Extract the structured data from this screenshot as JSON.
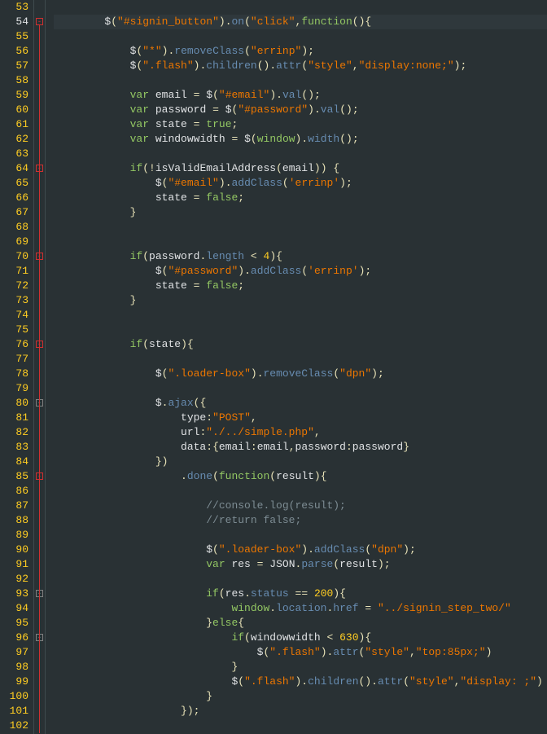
{
  "editor": {
    "first_line": 53,
    "last_line": 102,
    "highlighted_line": 54
  },
  "code_lines": [
    {
      "n": 53,
      "t": ""
    },
    {
      "n": 54,
      "t": "$(\"#signin_button\").on(\"click\",function(){",
      "i": 2
    },
    {
      "n": 55,
      "t": ""
    },
    {
      "n": 56,
      "t": "$(\"*\").removeClass(\"errinp\");",
      "i": 3
    },
    {
      "n": 57,
      "t": "$(\".flash\").children().attr(\"style\",\"display:none;\");",
      "i": 3
    },
    {
      "n": 58,
      "t": ""
    },
    {
      "n": 59,
      "t": "var email = $(\"#email\").val();",
      "i": 3
    },
    {
      "n": 60,
      "t": "var password = $(\"#password\").val();",
      "i": 3
    },
    {
      "n": 61,
      "t": "var state = true;",
      "i": 3
    },
    {
      "n": 62,
      "t": "var windowwidth = $(window).width();",
      "i": 3
    },
    {
      "n": 63,
      "t": ""
    },
    {
      "n": 64,
      "t": "if(!isValidEmailAddress(email)) {",
      "i": 3
    },
    {
      "n": 65,
      "t": "$(\"#email\").addClass('errinp');",
      "i": 4
    },
    {
      "n": 66,
      "t": "state = false;",
      "i": 4
    },
    {
      "n": 67,
      "t": "}",
      "i": 3
    },
    {
      "n": 68,
      "t": ""
    },
    {
      "n": 69,
      "t": ""
    },
    {
      "n": 70,
      "t": "if(password.length < 4){",
      "i": 3
    },
    {
      "n": 71,
      "t": "$(\"#password\").addClass('errinp');",
      "i": 4
    },
    {
      "n": 72,
      "t": "state = false;",
      "i": 4
    },
    {
      "n": 73,
      "t": "}",
      "i": 3
    },
    {
      "n": 74,
      "t": ""
    },
    {
      "n": 75,
      "t": ""
    },
    {
      "n": 76,
      "t": "if(state){",
      "i": 3
    },
    {
      "n": 77,
      "t": ""
    },
    {
      "n": 78,
      "t": "$(\".loader-box\").removeClass(\"dpn\");",
      "i": 4
    },
    {
      "n": 79,
      "t": ""
    },
    {
      "n": 80,
      "t": "$.ajax({",
      "i": 4
    },
    {
      "n": 81,
      "t": "type:\"POST\",",
      "i": 5
    },
    {
      "n": 82,
      "t": "url:\"./../simple.php\",",
      "i": 5
    },
    {
      "n": 83,
      "t": "data:{email:email,password:password}",
      "i": 5
    },
    {
      "n": 84,
      "t": "})",
      "i": 4
    },
    {
      "n": 85,
      "t": ".done(function(result){",
      "i": 5
    },
    {
      "n": 86,
      "t": ""
    },
    {
      "n": 87,
      "t": "//console.log(result);",
      "i": 6,
      "c": true
    },
    {
      "n": 88,
      "t": "//return false;",
      "i": 6,
      "c": true
    },
    {
      "n": 89,
      "t": ""
    },
    {
      "n": 90,
      "t": "$(\".loader-box\").addClass(\"dpn\");",
      "i": 6
    },
    {
      "n": 91,
      "t": "var res = JSON.parse(result);",
      "i": 6
    },
    {
      "n": 92,
      "t": ""
    },
    {
      "n": 93,
      "t": "if(res.status == 200){",
      "i": 6
    },
    {
      "n": 94,
      "t": "window.location.href = \"../signin_step_two/\"",
      "i": 7
    },
    {
      "n": 95,
      "t": "}else{",
      "i": 6
    },
    {
      "n": 96,
      "t": "if(windowwidth < 630){",
      "i": 7
    },
    {
      "n": 97,
      "t": "$(\".flash\").attr(\"style\",\"top:85px;\")",
      "i": 8
    },
    {
      "n": 98,
      "t": "}",
      "i": 7
    },
    {
      "n": 99,
      "t": "$(\".flash\").children().attr(\"style\",\"display: ;\")",
      "i": 7
    },
    {
      "n": 100,
      "t": "}",
      "i": 6
    },
    {
      "n": 101,
      "t": "});",
      "i": 5
    },
    {
      "n": 102,
      "t": ""
    }
  ],
  "fold_markers": {
    "54": "minus-red",
    "64": "minus-red",
    "67": "end",
    "70": "minus-red",
    "73": "end",
    "76": "minus-red",
    "80": "minus",
    "84": "mid",
    "85": "minus-red",
    "93": "minus",
    "95": "mid",
    "96": "minus",
    "98": "mid",
    "100": "mid",
    "101": "mid"
  },
  "theme": {
    "background": "#293134",
    "gutter_fg": "#81969a",
    "keyword": "#93c763",
    "method": "#678cb1",
    "string": "#ec7600",
    "number": "#ffcd22",
    "operator": "#e8e2b7",
    "comment": "#7d8c93",
    "default": "#e0e2e4"
  }
}
